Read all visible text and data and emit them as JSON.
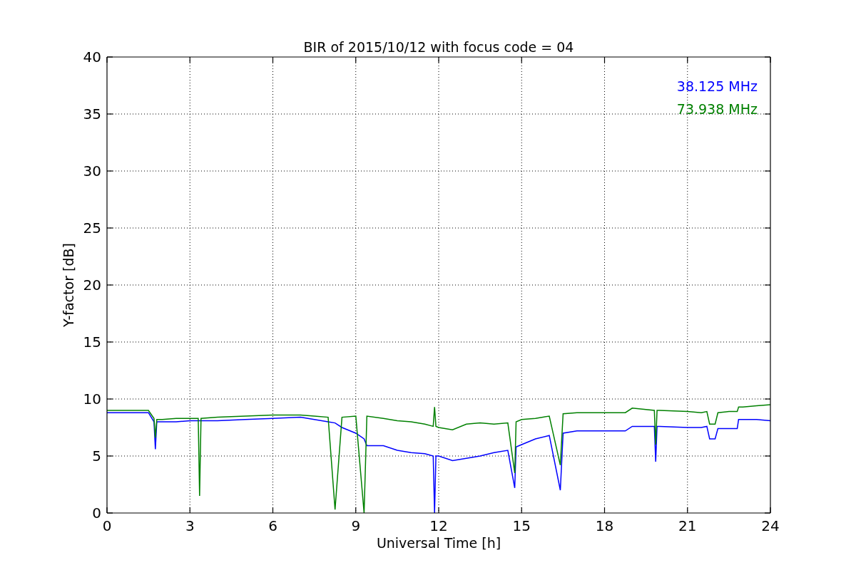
{
  "figure": {
    "chart_data": {
      "type": "line",
      "title": "BIR of 2015/10/12 with focus code = 04",
      "xlabel": "Universal Time [h]",
      "ylabel": "Y-factor [dB]",
      "x": [
        0,
        0.5,
        1,
        1.5,
        1.7,
        1.75,
        1.8,
        2,
        2.5,
        3,
        3.3,
        3.35,
        3.4,
        4,
        5,
        6,
        7,
        7.5,
        8,
        8.25,
        8.5,
        9,
        9.3,
        9.4,
        10,
        10.5,
        11,
        11.5,
        11.8,
        11.85,
        11.9,
        12,
        12.5,
        13,
        13.5,
        14,
        14.5,
        14.75,
        14.8,
        15,
        15.5,
        16,
        16.4,
        16.5,
        17,
        17.5,
        18,
        18.75,
        19,
        19.8,
        19.85,
        19.9,
        20,
        21,
        21.5,
        21.7,
        21.8,
        22,
        22.1,
        22.5,
        22.8,
        22.85,
        23,
        23.5,
        24
      ],
      "series": [
        {
          "name": "38.125 MHz",
          "color": "#0000ff",
          "values": [
            8.8,
            8.8,
            8.8,
            8.8,
            8.0,
            5.6,
            8.0,
            8.0,
            8.0,
            8.1,
            8.1,
            8.1,
            8.1,
            8.1,
            8.2,
            8.3,
            8.4,
            8.2,
            8.0,
            7.9,
            7.5,
            7.0,
            6.5,
            5.9,
            5.9,
            5.5,
            5.3,
            5.2,
            5.0,
            0,
            5.0,
            5.0,
            4.6,
            4.8,
            5.0,
            5.3,
            5.5,
            2.2,
            5.8,
            6.0,
            6.5,
            6.8,
            2.0,
            7.0,
            7.2,
            7.2,
            7.2,
            7.2,
            7.6,
            7.6,
            4.5,
            7.6,
            7.6,
            7.5,
            7.5,
            7.6,
            6.5,
            6.5,
            7.4,
            7.4,
            7.4,
            8.2,
            8.2,
            8.2,
            8.1
          ]
        },
        {
          "name": "73.938 MHz",
          "color": "#008000",
          "values": [
            9.0,
            9.0,
            9.0,
            9.0,
            8.3,
            6.6,
            8.2,
            8.2,
            8.3,
            8.3,
            8.3,
            1.5,
            8.3,
            8.4,
            8.5,
            8.6,
            8.6,
            8.5,
            8.4,
            0.3,
            8.4,
            8.5,
            0,
            8.5,
            8.3,
            8.1,
            8.0,
            7.8,
            7.6,
            9.3,
            7.6,
            7.5,
            7.3,
            7.8,
            7.9,
            7.8,
            7.9,
            3.5,
            8.0,
            8.2,
            8.3,
            8.5,
            4.2,
            8.7,
            8.8,
            8.8,
            8.8,
            8.8,
            9.2,
            9.0,
            6.0,
            9.0,
            9.0,
            8.9,
            8.8,
            8.9,
            7.8,
            7.8,
            8.8,
            8.9,
            8.9,
            9.3,
            9.3,
            9.4,
            9.5
          ]
        }
      ],
      "xlim": [
        0,
        24
      ],
      "ylim": [
        0,
        40
      ],
      "grid": true,
      "xticks": [
        0,
        3,
        6,
        9,
        12,
        15,
        18,
        21,
        24
      ],
      "yticks": [
        0,
        5,
        10,
        15,
        20,
        25,
        30,
        35,
        40
      ]
    }
  }
}
